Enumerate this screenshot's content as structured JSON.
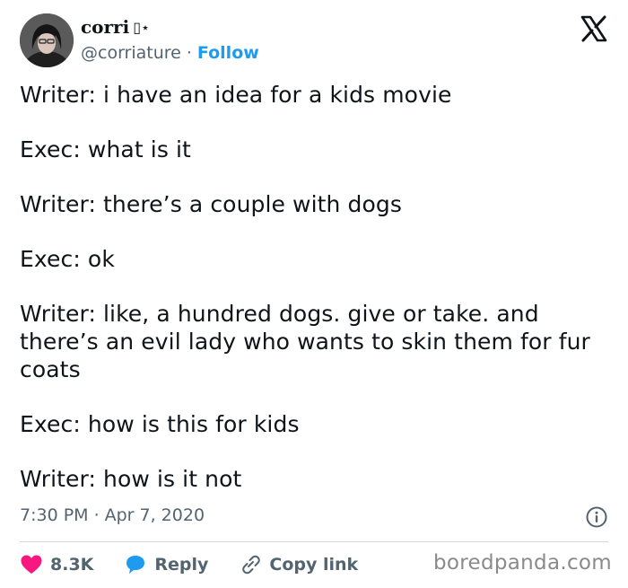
{
  "author": {
    "display_name": "corri",
    "name_glyphs": "▯⋆",
    "handle": "@corriature",
    "separator": "·",
    "follow_label": "Follow"
  },
  "tweet": {
    "lines": [
      "Writer: i have an idea for a kids movie",
      "Exec: what is it",
      "Writer: there’s a couple with dogs",
      "Exec: ok",
      "Writer: like, a hundred dogs. give or take. and there’s an evil lady who wants to skin them for fur coats",
      "Exec: how is this for kids",
      "Writer: how is it not"
    ],
    "time": "7:30 PM",
    "separator": "·",
    "date": "Apr 7, 2020"
  },
  "actions": {
    "likes": "8.3K",
    "reply_label": "Reply",
    "copy_label": "Copy link"
  },
  "watermark": "boredpanda.com",
  "colors": {
    "like": "#f91880",
    "reply": "#1d9bf0",
    "follow": "#1d9bf0",
    "muted": "#536471"
  },
  "icons": [
    "x-logo-icon",
    "info-icon",
    "heart-icon",
    "speech-bubble-icon",
    "link-icon"
  ]
}
